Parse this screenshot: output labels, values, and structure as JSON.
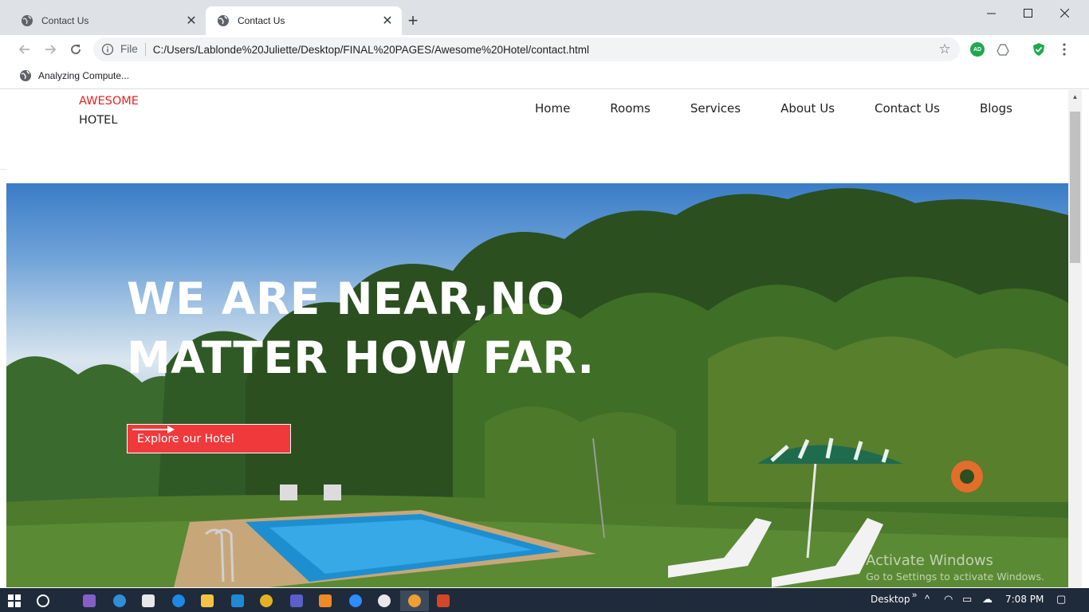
{
  "browser": {
    "tabs": [
      {
        "title": "Contact Us",
        "active": false
      },
      {
        "title": "Contact Us",
        "active": true
      }
    ],
    "new_tab_symbol": "+",
    "window_controls": {
      "minimize": "—",
      "maximize": "☐",
      "close": "✕"
    },
    "toolbar": {
      "scheme_label": "File",
      "url": "C:/Users/Lablonde%20Juliette/Desktop/FINAL%20PAGES/Awesome%20Hotel/contact.html",
      "extension_ad_label": "AD"
    },
    "bookmark": {
      "label": "Analyzing Compute..."
    }
  },
  "site": {
    "brand_line1": "AWESOME",
    "brand_line2": "HOTEL",
    "nav": [
      "Home",
      "Rooms",
      "Services",
      "About Us",
      "Contact Us",
      "Blogs"
    ],
    "hero": {
      "headline_line1": "WE ARE NEAR,NO",
      "headline_line2": "MATTER HOW FAR.",
      "cta_label": "Explore our Hotel"
    }
  },
  "watermark": {
    "line1": "Activate Windows",
    "line2": "Go to Settings to activate Windows."
  },
  "taskbar": {
    "desktop_label": "Desktop",
    "time": "7:08 PM"
  },
  "colors": {
    "brand_red": "#e8211e",
    "cta_red": "#f0393b",
    "taskbar": "#1f2a3a"
  }
}
